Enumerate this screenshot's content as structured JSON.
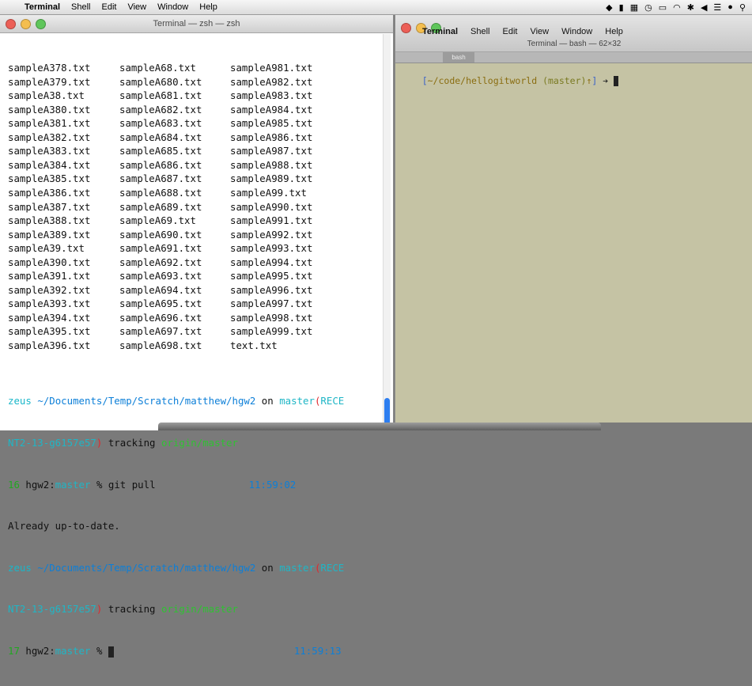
{
  "menubar": {
    "app": "Terminal",
    "items": [
      "Shell",
      "Edit",
      "View",
      "Window",
      "Help"
    ]
  },
  "left_window": {
    "title": "Terminal — zsh — zsh",
    "file_rows": [
      [
        "sampleA378.txt",
        "sampleA68.txt",
        "sampleA981.txt"
      ],
      [
        "sampleA379.txt",
        "sampleA680.txt",
        "sampleA982.txt"
      ],
      [
        "sampleA38.txt",
        "sampleA681.txt",
        "sampleA983.txt"
      ],
      [
        "sampleA380.txt",
        "sampleA682.txt",
        "sampleA984.txt"
      ],
      [
        "sampleA381.txt",
        "sampleA683.txt",
        "sampleA985.txt"
      ],
      [
        "sampleA382.txt",
        "sampleA684.txt",
        "sampleA986.txt"
      ],
      [
        "sampleA383.txt",
        "sampleA685.txt",
        "sampleA987.txt"
      ],
      [
        "sampleA384.txt",
        "sampleA686.txt",
        "sampleA988.txt"
      ],
      [
        "sampleA385.txt",
        "sampleA687.txt",
        "sampleA989.txt"
      ],
      [
        "sampleA386.txt",
        "sampleA688.txt",
        "sampleA99.txt"
      ],
      [
        "sampleA387.txt",
        "sampleA689.txt",
        "sampleA990.txt"
      ],
      [
        "sampleA388.txt",
        "sampleA69.txt",
        "sampleA991.txt"
      ],
      [
        "sampleA389.txt",
        "sampleA690.txt",
        "sampleA992.txt"
      ],
      [
        "sampleA39.txt",
        "sampleA691.txt",
        "sampleA993.txt"
      ],
      [
        "sampleA390.txt",
        "sampleA692.txt",
        "sampleA994.txt"
      ],
      [
        "sampleA391.txt",
        "sampleA693.txt",
        "sampleA995.txt"
      ],
      [
        "sampleA392.txt",
        "sampleA694.txt",
        "sampleA996.txt"
      ],
      [
        "sampleA393.txt",
        "sampleA695.txt",
        "sampleA997.txt"
      ],
      [
        "sampleA394.txt",
        "sampleA696.txt",
        "sampleA998.txt"
      ],
      [
        "sampleA395.txt",
        "sampleA697.txt",
        "sampleA999.txt"
      ],
      [
        "sampleA396.txt",
        "sampleA698.txt",
        "text.txt"
      ]
    ],
    "prompt1": {
      "host": "zeus",
      "path": "~/Documents/Temp/Scratch/matthew/hgw2",
      "on": "on",
      "branch": "master",
      "paren_open": "(",
      "ref_a": "RECE",
      "ref_b": "NT2-13-g6157e57",
      "paren_close": ")",
      "tracking": "tracking",
      "origin": "origin/master"
    },
    "cmd1": {
      "num": "16",
      "repo": "hgw2",
      "branch": "master",
      "sym": "%",
      "command": "git pull",
      "time": "11:59:02"
    },
    "output1": "Already up-to-date.",
    "prompt2": {
      "host": "zeus",
      "path": "~/Documents/Temp/Scratch/matthew/hgw2",
      "on": "on",
      "branch": "master",
      "paren_open": "(",
      "ref_a": "RECE",
      "ref_b": "NT2-13-g6157e57",
      "paren_close": ")",
      "tracking": "tracking",
      "origin": "origin/master"
    },
    "cmd2": {
      "num": "17",
      "repo": "hgw2",
      "branch": "master",
      "sym": "%",
      "time": "11:59:13"
    }
  },
  "right_window": {
    "inner_menu": {
      "app": "Terminal",
      "items": [
        "Shell",
        "Edit",
        "View",
        "Window",
        "Help"
      ]
    },
    "title": "Terminal — bash — 62×32",
    "tab_label": "bash",
    "prompt": {
      "open": "[",
      "path": "~/code/hellogitworld",
      "branch": "(master)",
      "ahead": "↑",
      "close": "]",
      "arrow": "➔"
    }
  },
  "colors": {
    "right_bg": "#c5c3a4",
    "accent_blue": "#0c7fd8",
    "accent_cyan": "#19b7c9",
    "accent_red": "#e0282e",
    "accent_green": "#2fc232"
  }
}
